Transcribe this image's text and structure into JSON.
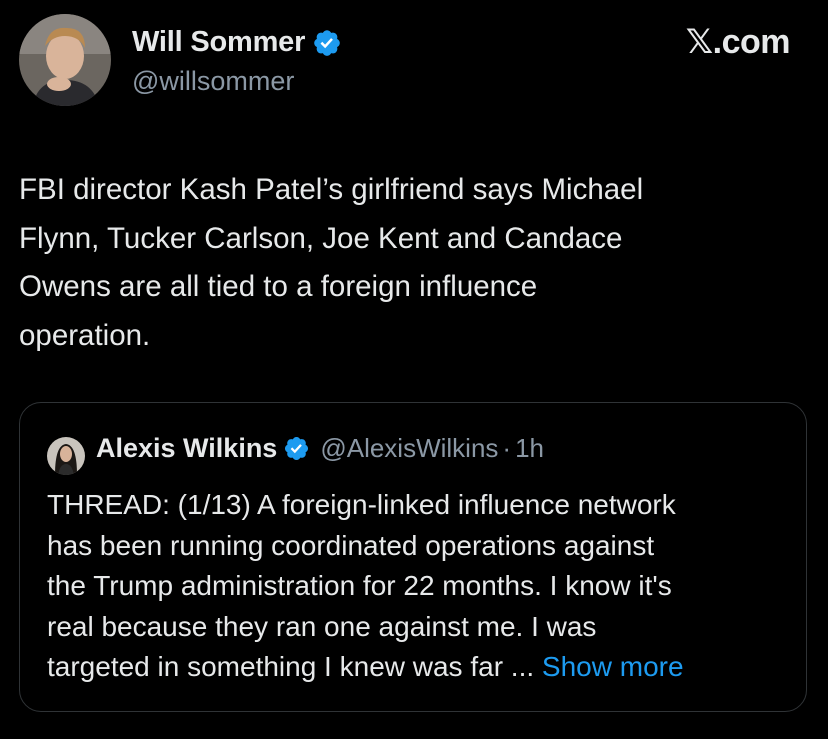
{
  "author": {
    "name": "Will Sommer",
    "handle": "@willsommer",
    "verified": true
  },
  "site_label": "𝕏.com",
  "tweet": {
    "lines": [
      "FBI director Kash Patel’s girlfriend says Michael",
      "Flynn, Tucker Carlson, Joe Kent and Candace",
      "Owens are all tied to a foreign influence",
      "operation."
    ]
  },
  "quoted": {
    "name": "Alexis Wilkins",
    "handle": "@AlexisWilkins",
    "separator": "·",
    "time": "1h",
    "verified": true,
    "lines": [
      "THREAD: (1/13) A foreign-linked influence network",
      "has been running coordinated operations against",
      "the Trump administration for 22 months. I know it's",
      "real because they ran one against me. I was",
      "targeted in something I knew was far ... "
    ],
    "show_more": "Show more"
  },
  "colors": {
    "background": "#000000",
    "text": "#e7e9ea",
    "secondary": "#8b98a5",
    "accent": "#1d9bf0",
    "border": "#2f3336"
  },
  "icons": {
    "verified": "verified-badge-icon",
    "avatar": "profile-photo",
    "quoted_avatar": "profile-photo"
  }
}
